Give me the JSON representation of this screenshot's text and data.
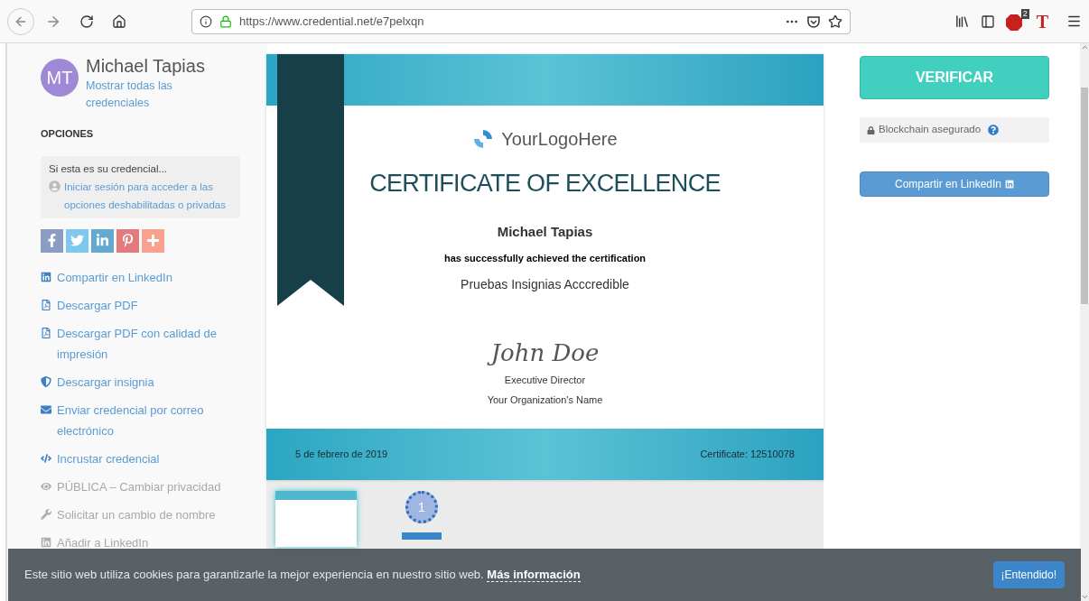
{
  "browser": {
    "url": "https://www.credential.net/e7pelxqn",
    "adblock_count": "2",
    "extension_letter": "T"
  },
  "profile": {
    "initials": "MT",
    "name": "Michael Tapias",
    "link": "Mostrar todas las credenciales"
  },
  "options_heading": "OPCIONES",
  "login_box": {
    "text": "Si esta es su credencial...",
    "link": "Iniciar sesión para acceder a las opciones deshabilitadas o privadas"
  },
  "share_icons": [
    {
      "kind": "facebook",
      "color": "#8b9dc3"
    },
    {
      "kind": "twitter",
      "color": "#7ec8ef"
    },
    {
      "kind": "linkedin",
      "color": "#64a9cf"
    },
    {
      "kind": "pinterest",
      "color": "#e27a7e"
    },
    {
      "kind": "plus",
      "color": "#f9a08f"
    }
  ],
  "actions": [
    {
      "kind": "linkedin",
      "label": "Compartir en LinkedIn",
      "disabled": false
    },
    {
      "kind": "pdf",
      "label": "Descargar PDF",
      "disabled": false
    },
    {
      "kind": "pdf",
      "label": "Descargar PDF con calidad de impresión",
      "disabled": false
    },
    {
      "kind": "shield",
      "label": "Descargar insignia",
      "disabled": false
    },
    {
      "kind": "mail",
      "label": "Enviar credencial por correo electrónico",
      "disabled": false
    },
    {
      "kind": "code",
      "label": "Incrustar credencial",
      "disabled": false
    },
    {
      "kind": "eye",
      "label": "PÚBLICA – Cambiar privacidad",
      "disabled": true
    },
    {
      "kind": "wrench",
      "label": "Solicitar un cambio de nombre",
      "disabled": true
    },
    {
      "kind": "linkedin",
      "label": "Añadir a LinkedIn",
      "disabled": true
    }
  ],
  "certificate": {
    "logo_text": "YourLogoHere",
    "title": "CERTIFICATE OF EXCELLENCE",
    "recipient": "Michael Tapias",
    "achieved": "has successfully achieved the certification",
    "course": "Pruebas Insignias Acccredible",
    "signature": "John Doe",
    "signer_title": "Executive Director",
    "organization": "Your Organization's Name",
    "date": "5 de febrero de 2019",
    "number": "Certificate: 12510078"
  },
  "thumbnails": [
    {
      "kind": "certificate",
      "selected": true
    },
    {
      "kind": "badge",
      "selected": false,
      "number": "1"
    }
  ],
  "side_panel": {
    "verify_button": "VERIFICAR",
    "blockchain": "Blockchain asegurado",
    "share_button": "Compartir en LinkedIn"
  },
  "cookie_banner": {
    "text": "Este sitio web utiliza cookies para garantizarle la mejor experiencia en nuestro sitio web.",
    "link": "Más información",
    "button": "¡Entendido!"
  }
}
